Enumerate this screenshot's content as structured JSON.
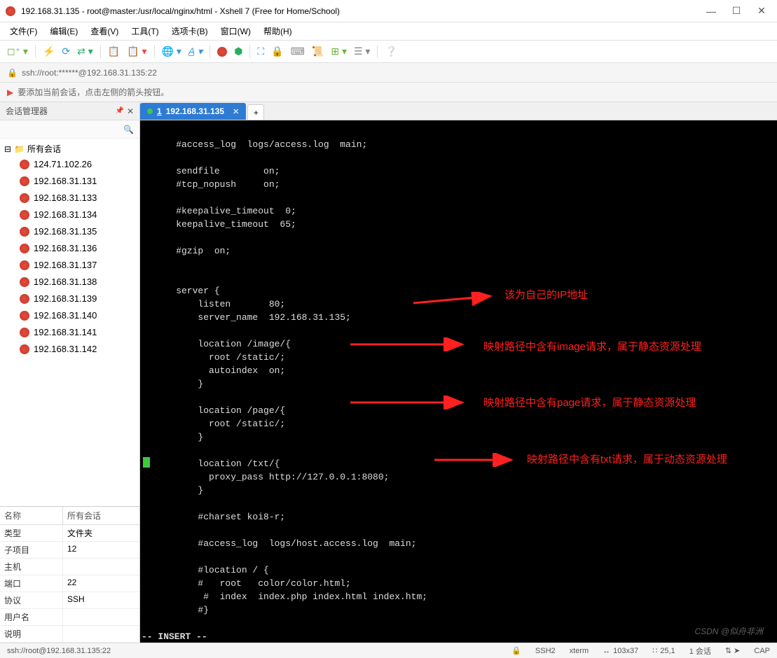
{
  "window": {
    "title": "192.168.31.135 - root@master:/usr/local/nginx/html - Xshell 7 (Free for Home/School)"
  },
  "menus": [
    "文件(F)",
    "编辑(E)",
    "查看(V)",
    "工具(T)",
    "选项卡(B)",
    "窗口(W)",
    "帮助(H)"
  ],
  "address": "ssh://root:******@192.168.31.135:22",
  "hint": "要添加当前会话，点击左侧的箭头按钮。",
  "sidebar": {
    "title": "会话管理器",
    "root": "所有会话",
    "items": [
      "124.71.102.26",
      "192.168.31.131",
      "192.168.31.133",
      "192.168.31.134",
      "192.168.31.135",
      "192.168.31.136",
      "192.168.31.137",
      "192.168.31.138",
      "192.168.31.139",
      "192.168.31.140",
      "192.168.31.141",
      "192.168.31.142"
    ]
  },
  "props": {
    "headers": [
      "名称",
      "所有会话"
    ],
    "rows": [
      [
        "类型",
        "文件夹"
      ],
      [
        "子项目",
        "12"
      ],
      [
        "主机",
        ""
      ],
      [
        "端口",
        "22"
      ],
      [
        "协议",
        "SSH"
      ],
      [
        "用户名",
        ""
      ],
      [
        "说明",
        ""
      ]
    ]
  },
  "tab": {
    "num": "1",
    "ip": "192.168.31.135"
  },
  "terminal_lines": [
    "    #access_log  logs/access.log  main;",
    "",
    "    sendfile        on;",
    "    #tcp_nopush     on;",
    "",
    "    #keepalive_timeout  0;",
    "    keepalive_timeout  65;",
    "",
    "    #gzip  on;",
    "",
    "",
    "    server {",
    "        listen       80;",
    "        server_name  192.168.31.135;",
    "",
    "        location /image/{",
    "          root /static/;",
    "          autoindex  on;",
    "        }",
    "",
    "        location /page/{",
    "          root /static/;",
    "        }",
    "",
    "        location /txt/{",
    "          proxy_pass http://127.0.0.1:8080;",
    "        }",
    "",
    "        #charset koi8-r;",
    "",
    "        #access_log  logs/host.access.log  main;",
    "",
    "        #location / {",
    "        #   root   color/color.html;",
    "         #  index  index.php index.html index.htm;",
    "        #}"
  ],
  "vim_mode": "-- INSERT --",
  "annotations": {
    "a1": "该为自己的IP地址",
    "a2": "映射路径中含有image请求，属于静态资源处理",
    "a3": "映射路径中含有page请求，属于静态资源处理",
    "a4": "映射路径中含有txt请求，属于动态资源处理"
  },
  "status": {
    "left": "ssh://root@192.168.31.135:22",
    "ssh": "SSH2",
    "term": "xterm",
    "size": "103x37",
    "pos": "25,1",
    "sess": "1 会话",
    "cap": "CAP"
  },
  "watermark": "CSDN @似舟非洲"
}
